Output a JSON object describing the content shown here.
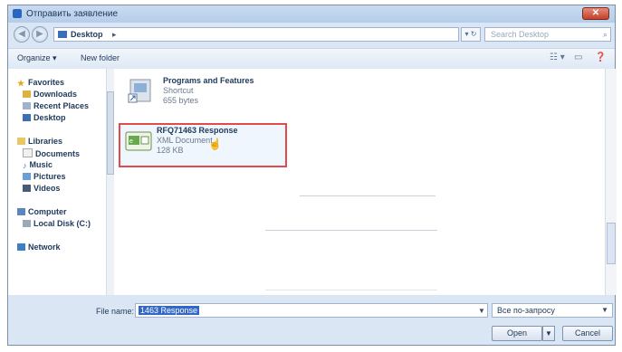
{
  "window": {
    "title": "Отправить заявление",
    "close_glyph": "✕"
  },
  "address": {
    "back_glyph": "◀",
    "forward_glyph": "▶",
    "location": "Desktop",
    "chevron": "▸",
    "refresh_glyph": "▾ ↻",
    "search_placeholder": "Search Desktop",
    "search_icon": "⌕"
  },
  "commands": {
    "organize": "Organize ▾",
    "new_folder": "New folder",
    "view_icon": "☷ ▾",
    "preview_icon": "▭",
    "help_icon": "❓"
  },
  "sidebar": {
    "items": [
      {
        "label": "Favorites",
        "icon": "star-icon"
      },
      {
        "label": "Downloads",
        "icon": "download-icon"
      },
      {
        "label": "Recent Places",
        "icon": "recent-places-icon"
      },
      {
        "label": "Desktop",
        "icon": "desktop-icon"
      },
      {
        "label": "Libraries",
        "icon": "library-icon"
      },
      {
        "label": "Documents",
        "icon": "documents-icon"
      },
      {
        "label": "Music",
        "icon": "music-icon"
      },
      {
        "label": "Pictures",
        "icon": "pictures-icon"
      },
      {
        "label": "Videos",
        "icon": "videos-icon"
      },
      {
        "label": "Computer",
        "icon": "computer-icon"
      },
      {
        "label": "Local Disk (C:)",
        "icon": "disk-icon"
      },
      {
        "label": "Network",
        "icon": "network-icon"
      }
    ]
  },
  "files": [
    {
      "name": "Programs and Features",
      "type": "Shortcut",
      "size": "655 bytes"
    },
    {
      "name": "RFQ71463 Response",
      "type": "XML Document",
      "size": "128 KB"
    }
  ],
  "bottom": {
    "file_name_label": "File name:",
    "file_name_value": "1463 Response",
    "file_type": "Все по-запросу",
    "open_label": "Open",
    "cancel_label": "Cancel"
  },
  "colors": {
    "accent": "#3168c6",
    "highlight_border": "#e04b4b",
    "close": "#c2412b"
  }
}
